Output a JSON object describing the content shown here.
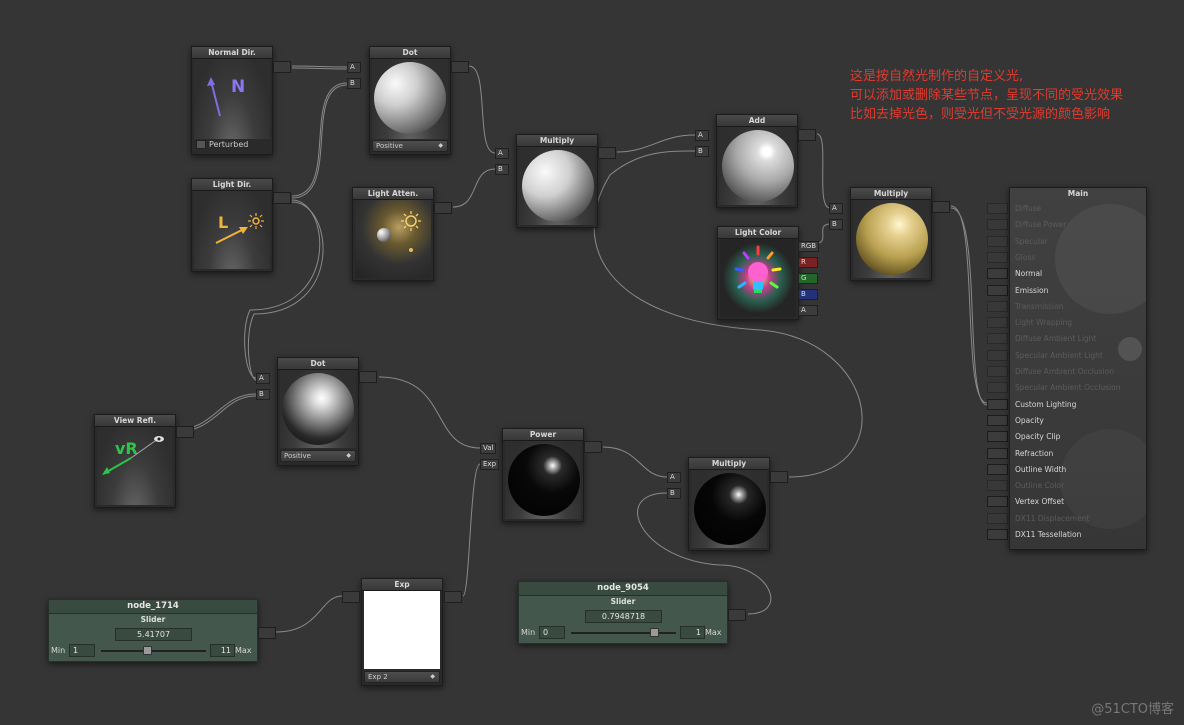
{
  "annotation": {
    "lines": [
      "这是按自然光制作的自定义光,",
      "可以添加或删除某些节点，呈现不同的受光效果",
      "比如去掉光色，则受光但不受光源的颜色影响"
    ]
  },
  "watermark": "@51CTO博客",
  "nodes": {
    "normal_dir": {
      "title": "Normal Dir.",
      "glyph": "N",
      "checkbox_label": "Perturbed"
    },
    "light_dir": {
      "title": "Light Dir.",
      "glyph": "L"
    },
    "light_atten": {
      "title": "Light Atten."
    },
    "view_refl": {
      "title": "View Refl.",
      "glyph": "vR"
    },
    "dot1": {
      "title": "Dot",
      "dropdown": "Positive",
      "ports": [
        "A",
        "B"
      ]
    },
    "dot2": {
      "title": "Dot",
      "dropdown": "Positive",
      "ports": [
        "A",
        "B"
      ]
    },
    "multiply1": {
      "title": "Multiply",
      "ports": [
        "A",
        "B"
      ]
    },
    "add": {
      "title": "Add",
      "ports": [
        "A",
        "B"
      ]
    },
    "light_color": {
      "title": "Light Color",
      "ports": [
        "RGB",
        "R",
        "G",
        "B",
        "A"
      ]
    },
    "multiply2": {
      "title": "Multiply",
      "ports": [
        "A",
        "B"
      ]
    },
    "power": {
      "title": "Power",
      "ports": [
        "Val",
        "Exp"
      ]
    },
    "multiply3": {
      "title": "Multiply",
      "ports": [
        "A",
        "B"
      ]
    },
    "exp": {
      "title": "Exp",
      "dropdown": "Exp 2"
    }
  },
  "sliders": [
    {
      "name": "node_1714",
      "type": "Slider",
      "value": "5.41707",
      "min_label": "Min",
      "min": "1",
      "max_label": "Max",
      "max": "11",
      "fraction": 0.44
    },
    {
      "name": "node_9054",
      "type": "Slider",
      "value": "0.7948718",
      "min_label": "Min",
      "min": "0",
      "max_label": "Max",
      "max": "1",
      "fraction": 0.79
    }
  ],
  "main": {
    "title": "Main",
    "inputs": [
      {
        "label": "Diffuse",
        "active": false
      },
      {
        "label": "Diffuse Power",
        "active": false
      },
      {
        "label": "Specular",
        "active": false
      },
      {
        "label": "Gloss",
        "active": false
      },
      {
        "label": "Normal",
        "active": true
      },
      {
        "label": "Emission",
        "active": true
      },
      {
        "label": "Transmission",
        "active": false
      },
      {
        "label": "Light Wrapping",
        "active": false
      },
      {
        "label": "Diffuse Ambient Light",
        "active": false
      },
      {
        "label": "Specular Ambient Light",
        "active": false
      },
      {
        "label": "Diffuse Ambient Occlusion",
        "active": false
      },
      {
        "label": "Specular Ambient Occlusion",
        "active": false
      },
      {
        "label": "Custom Lighting",
        "active": true
      },
      {
        "label": "Opacity",
        "active": true
      },
      {
        "label": "Opacity Clip",
        "active": true
      },
      {
        "label": "Refraction",
        "active": true
      },
      {
        "label": "Outline Width",
        "active": true
      },
      {
        "label": "Outline Color",
        "active": false
      },
      {
        "label": "Vertex Offset",
        "active": true
      },
      {
        "label": "DX11 Displacement",
        "active": false
      },
      {
        "label": "DX11 Tessellation",
        "active": true
      }
    ],
    "colors": {
      "active": "#d8d8d8",
      "inactive": "#5c5c5c"
    }
  },
  "colors": {
    "background": "#353535",
    "annotation": "#e03b2f",
    "normal_arrow": "#7d6fe0",
    "light_arrow": "#f0b43c",
    "view_arrow": "#2ec44a",
    "port_r": "#7a2222",
    "port_g": "#22662a",
    "port_b": "#23307a"
  }
}
